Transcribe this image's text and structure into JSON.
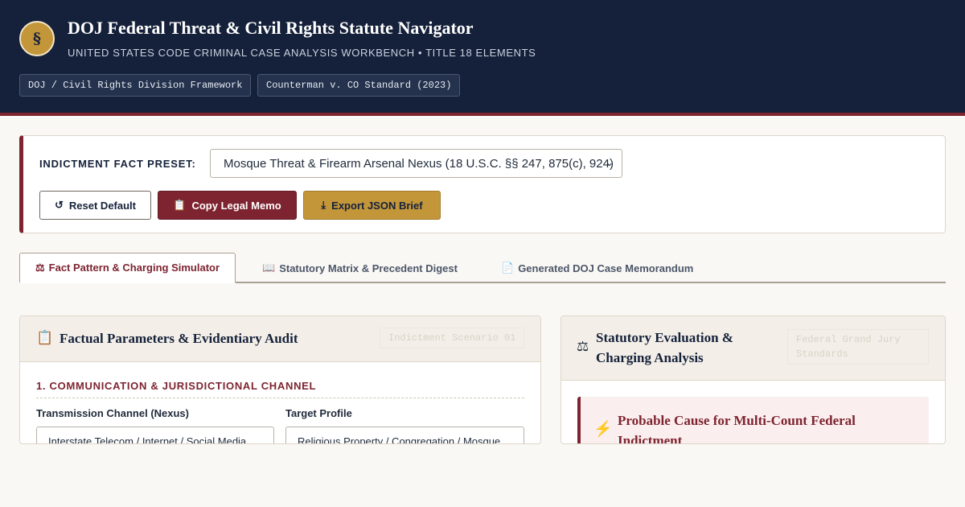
{
  "header": {
    "seal_symbol": "§",
    "title": "DOJ Federal Threat & Civil Rights Statute Navigator",
    "subtitle": "UNITED STATES CODE CRIMINAL CASE ANALYSIS WORKBENCH • TITLE 18 ELEMENTS",
    "badges": [
      "DOJ / Civil Rights Division Framework",
      "Counterman v. CO Standard (2023)"
    ]
  },
  "preset": {
    "label": "INDICTMENT FACT PRESET:",
    "selected": "Mosque Threat & Firearm Arsenal Nexus (18 U.S.C. §§ 247, 875(c), 924)"
  },
  "actions": {
    "reset_icon": "↺",
    "reset_label": "Reset Default",
    "copy_icon": "📋",
    "copy_label": "Copy Legal Memo",
    "export_icon": "⤓",
    "export_label": "Export JSON Brief"
  },
  "tabs": [
    {
      "icon": "⚖",
      "label": "Fact Pattern & Charging Simulator",
      "active": true
    },
    {
      "icon": "📖",
      "label": "Statutory Matrix & Precedent Digest",
      "active": false
    },
    {
      "icon": "📄",
      "label": "Generated DOJ Case Memorandum",
      "active": false
    }
  ],
  "left_panel": {
    "icon": "📋",
    "title": "Factual Parameters & Evidentiary Audit",
    "tag": "Indictment Scenario 01",
    "section": "1. COMMUNICATION & JURISDICTIONAL CHANNEL",
    "fields": [
      {
        "label": "Transmission Channel (Nexus)",
        "value": "Interstate Telecom / Internet / Social Media"
      },
      {
        "label": "Target Profile",
        "value": "Religious Property / Congregation / Mosque"
      }
    ]
  },
  "right_panel": {
    "icon": "⚖",
    "title_line1": "Statutory Evaluation &",
    "title_line2": "Charging Analysis",
    "tag_line1": "Federal Grand Jury",
    "tag_line2": "Standards",
    "alert_icon": "⚡",
    "alert_title": "Probable Cause for Multi-Count Federal Indictment"
  },
  "colors": {
    "navy": "#15213a",
    "burgundy": "#7d2430",
    "gold": "#c3963a",
    "background": "#faf8f4"
  }
}
